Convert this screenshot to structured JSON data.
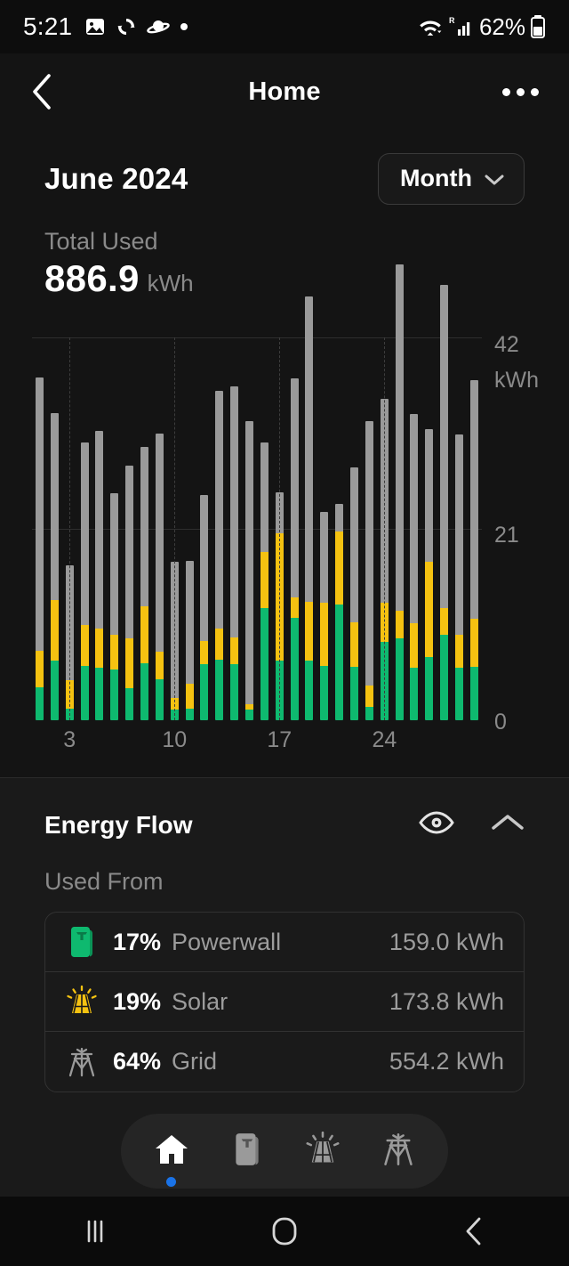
{
  "status_bar": {
    "time": "5:21",
    "battery_percent": "62%",
    "left_icons": [
      "image-icon",
      "sync-icon",
      "saturn-icon",
      "dot-icon"
    ],
    "right_icons": [
      "wifi-icon",
      "roaming-signal-icon",
      "battery-icon"
    ]
  },
  "app_bar": {
    "title": "Home",
    "back_icon": "chevron-left-icon",
    "overflow_icon": "more-options-icon"
  },
  "summary": {
    "period_title": "June 2024",
    "range_button_label": "Month",
    "range_button_icon": "chevron-down-icon",
    "total_label": "Total Used",
    "total_value": "886.9",
    "total_unit": "kWh"
  },
  "chart_data": {
    "type": "bar",
    "title": "",
    "stacked": true,
    "xlabel": "",
    "ylabel": "kWh",
    "ylim": [
      0,
      42
    ],
    "yticks": [
      "0",
      "21",
      "42"
    ],
    "ytick_top_unit": "kWh",
    "grid": true,
    "xticks": [
      "3",
      "10",
      "17",
      "24"
    ],
    "xtick_days": [
      3,
      10,
      17,
      24
    ],
    "categories": [
      1,
      2,
      3,
      4,
      5,
      6,
      7,
      8,
      9,
      10,
      11,
      12,
      13,
      14,
      15,
      16,
      17,
      18,
      19,
      20,
      21,
      22,
      23,
      24,
      25,
      26,
      27,
      28,
      29,
      30
    ],
    "series": [
      {
        "name": "Powerwall",
        "color": "#0eb96f",
        "values": [
          3.6,
          6.5,
          1.3,
          6.0,
          5.8,
          5.6,
          3.5,
          6.3,
          4.5,
          1.2,
          1.3,
          6.2,
          6.6,
          6.2,
          1.2,
          12.3,
          6.5,
          11.2,
          6.5,
          6.0,
          12.7,
          5.9,
          1.5,
          8.6,
          9.0,
          5.8,
          6.9,
          9.4,
          5.8,
          5.9
        ]
      },
      {
        "name": "Solar",
        "color": "#f5c211",
        "values": [
          4.0,
          6.7,
          3.1,
          4.5,
          4.3,
          3.8,
          5.5,
          6.2,
          3.0,
          1.2,
          2.7,
          2.5,
          3.5,
          2.9,
          0.6,
          6.2,
          14.0,
          2.3,
          6.5,
          6.9,
          8.0,
          4.8,
          2.3,
          4.3,
          3.0,
          4.8,
          10.5,
          2.9,
          3.6,
          5.2
        ]
      },
      {
        "name": "Grid",
        "color": "#9a9a9a",
        "values": [
          30.0,
          20.5,
          12.6,
          20.0,
          21.6,
          15.5,
          18.9,
          17.5,
          24.0,
          15.0,
          13.5,
          16.0,
          26.0,
          27.5,
          31.0,
          12.0,
          4.5,
          24.0,
          33.5,
          10.0,
          3.0,
          17.0,
          29.0,
          22.4,
          38.0,
          23.0,
          14.5,
          35.5,
          22.0,
          26.2
        ]
      }
    ],
    "legend": [
      "Powerwall",
      "Solar",
      "Grid"
    ],
    "legend_position": "none"
  },
  "energy_flow": {
    "title": "Energy Flow",
    "eye_icon": "eye-icon",
    "collapse_icon": "chevron-up-icon",
    "used_from_label": "Used From",
    "rows": [
      {
        "icon": "powerwall-icon",
        "percent": "17%",
        "name": "Powerwall",
        "value": "159.0 kWh",
        "color": "#0eb96f"
      },
      {
        "icon": "solar-icon",
        "percent": "19%",
        "name": "Solar",
        "value": "173.8 kWh",
        "color": "#f5c211"
      },
      {
        "icon": "grid-icon",
        "percent": "64%",
        "name": "Grid",
        "value": "554.2 kWh",
        "color": "#9a9a9a"
      }
    ]
  },
  "tab_bar": {
    "items": [
      {
        "icon": "home-icon",
        "active": true
      },
      {
        "icon": "powerwall-icon",
        "active": false
      },
      {
        "icon": "solar-icon",
        "active": false
      },
      {
        "icon": "grid-icon",
        "active": false
      }
    ],
    "active_dot_color": "#1a73e8"
  },
  "nav_bar": {
    "recents_icon": "recents-icon",
    "home_icon": "home-circle-icon",
    "back_icon": "back-icon"
  }
}
